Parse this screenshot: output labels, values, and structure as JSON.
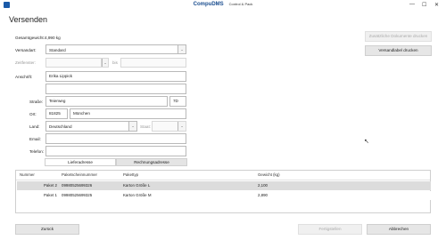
{
  "window": {
    "brand": "CompuDMS",
    "subtitle": "Control & Pack",
    "controls": {
      "minimize": "—",
      "maximize": "☐",
      "close": "✕"
    }
  },
  "page_title": "Versenden",
  "form": {
    "gesamtgewicht_label": "Gesamtgewicht:",
    "gesamtgewicht_value": "4,990 kg",
    "versandart_label": "Versandart:",
    "versandart_value": "Standard",
    "zeitfenster_label": "Zeitfenster:",
    "zeitfenster_bis": "bis",
    "anschrift_label": "Anschrift:",
    "anschrift_line1": "Erika Lippick",
    "anschrift_line2": "",
    "strasse_label": "Straße:",
    "strasse_value": "Teierweg",
    "hausnummer_value": "7D",
    "ort_label": "Ort:",
    "plz_value": "81825",
    "ort_value": "München",
    "land_label": "Land:",
    "land_value": "Deutschland",
    "staat_label": "Staat:",
    "email_label": "Email:",
    "email_value": "",
    "telefon_label": "Telefon:",
    "telefon_value": ""
  },
  "tabs": {
    "lieferadresse": "Lieferadresse",
    "rechnungsadresse": "Rechnungsadresse"
  },
  "side_buttons": {
    "zusaetzliche_dokumente": "Zusätzliche Dokumente drucken",
    "versandlabel": "Versandlabel drucken"
  },
  "table": {
    "headers": [
      "Nummer",
      "Paketscheinnummer",
      "Pakettyp",
      "Gewicht (kg)"
    ],
    "rows": [
      [
        "Paket 2",
        "09980525699326",
        "Karton Größe L",
        "2,100"
      ],
      [
        "Paket 1",
        "09980525699325",
        "Karton Größe M",
        "2,890"
      ]
    ]
  },
  "footer": {
    "zurueck": "Zurück",
    "fertigstellen": "Fertigstellen",
    "abbrechen": "Abbrechen"
  },
  "colors": {
    "brand": "#1a4d8f",
    "selected_row": "#dcdcdc",
    "button_bg": "#e6e6e6"
  }
}
